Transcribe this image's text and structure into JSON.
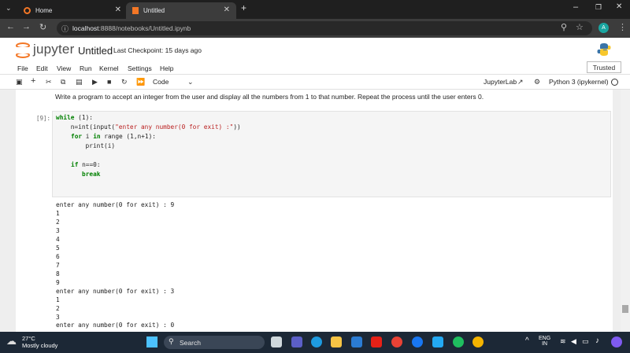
{
  "browser": {
    "tabs": [
      {
        "label": "Home",
        "active": false
      },
      {
        "label": "Untitled",
        "active": true
      }
    ],
    "url_host": "localhost",
    "url_path": ":8888/notebooks/Untitled.ipynb"
  },
  "jupyter": {
    "logo_text": "jupyter",
    "notebook_title": "Untitled",
    "checkpoint": "Last Checkpoint: 15 days ago",
    "trusted_label": "Trusted",
    "menu": [
      "File",
      "Edit",
      "View",
      "Run",
      "Kernel",
      "Settings",
      "Help"
    ],
    "cell_type": "Code",
    "jupyterlab_label": "JupyterLab",
    "kernel": "Python 3 (ipykernel)"
  },
  "notebook": {
    "markdown": "Write a program to accept an integer from the user and display all the numbers from 1 to that number. Repeat the process until the user enters 0.",
    "prompt": "[9]:",
    "code": {
      "l1_kw": "while",
      "l1_rest": " (1):",
      "l2_a": "    n=int(input(",
      "l2_str": "\"enter any number(0 for exit) :\"",
      "l2_b": "))",
      "l3_kw1": "for",
      "l3_mid": " i ",
      "l3_kw2": "in",
      "l3_rest": " range (1,n+1):",
      "l4": "        print(i)",
      "l6_kw": "if",
      "l6_rest": " n==0:",
      "l7_kw": "break"
    },
    "output": [
      "enter any number(0 for exit) : 9",
      "1",
      "2",
      "3",
      "4",
      "5",
      "6",
      "7",
      "8",
      "9",
      "enter any number(0 for exit) : 3",
      "1",
      "2",
      "3",
      "enter any number(0 for exit) : 0"
    ]
  },
  "taskbar": {
    "temperature": "27°C",
    "weather": "Mostly cloudy",
    "search": "Search",
    "lang1": "ENG",
    "lang2": "IN"
  }
}
